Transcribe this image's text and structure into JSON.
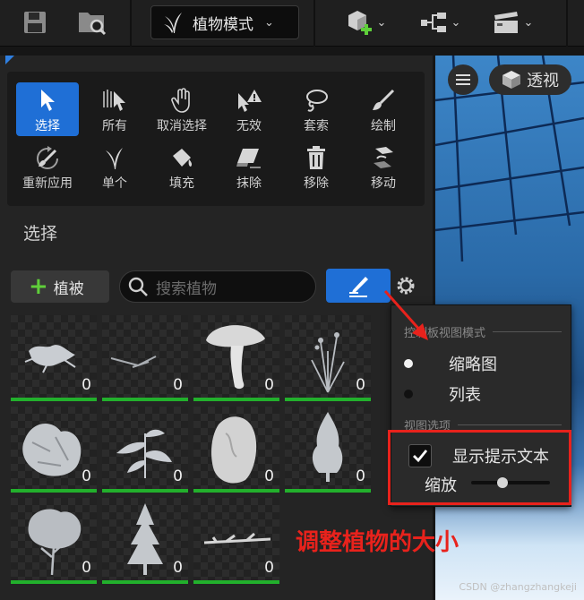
{
  "toolbar": {
    "mode_label": "植物模式"
  },
  "tools": [
    {
      "label": "选择",
      "icon": "cursor-icon",
      "active": true
    },
    {
      "label": "所有",
      "icon": "select-all-icon",
      "active": false
    },
    {
      "label": "取消选择",
      "icon": "hand-icon",
      "active": false
    },
    {
      "label": "无效",
      "icon": "invalid-icon",
      "active": false
    },
    {
      "label": "套索",
      "icon": "lasso-icon",
      "active": false
    },
    {
      "label": "绘制",
      "icon": "brush-icon",
      "active": false
    },
    {
      "label": "重新应用",
      "icon": "reapply-icon",
      "active": false
    },
    {
      "label": "单个",
      "icon": "single-grass-icon",
      "active": false
    },
    {
      "label": "填充",
      "icon": "fill-bucket-icon",
      "active": false
    },
    {
      "label": "抹除",
      "icon": "eraser-icon",
      "active": false
    },
    {
      "label": "移除",
      "icon": "trash-icon",
      "active": false
    },
    {
      "label": "移动",
      "icon": "move-icon",
      "active": false
    }
  ],
  "section": {
    "title": "选择"
  },
  "foliage_bar": {
    "add_label": "植被",
    "search_placeholder": "搜索植物"
  },
  "thumbnails": [
    {
      "count": "0",
      "kind": "shrub"
    },
    {
      "count": "0",
      "kind": "twig"
    },
    {
      "count": "0",
      "kind": "mushroom"
    },
    {
      "count": "0",
      "kind": "weed"
    },
    {
      "count": "0",
      "kind": "bush"
    },
    {
      "count": "0",
      "kind": "leafy-plant"
    },
    {
      "count": "0",
      "kind": "rock"
    },
    {
      "count": "0",
      "kind": "conifer"
    },
    {
      "count": "0",
      "kind": "tree"
    },
    {
      "count": "0",
      "kind": "pine"
    },
    {
      "count": "0",
      "kind": "branch"
    }
  ],
  "viewport": {
    "view_label": "透视"
  },
  "popup": {
    "palette_header": "控制板视图模式",
    "option_thumbnail": "缩略图",
    "option_list": "列表",
    "view_header": "视图选项",
    "show_tooltip_label": "显示提示文本",
    "show_tooltip_checked": true,
    "zoom_label": "缩放",
    "zoom_fraction": 0.4
  },
  "annotation": "调整植物的大小",
  "watermark": "CSDN @zhangzhangkeji",
  "colors": {
    "accent": "#1f6fd6",
    "annotation": "#e8221c",
    "count_bar": "#22b02c"
  }
}
